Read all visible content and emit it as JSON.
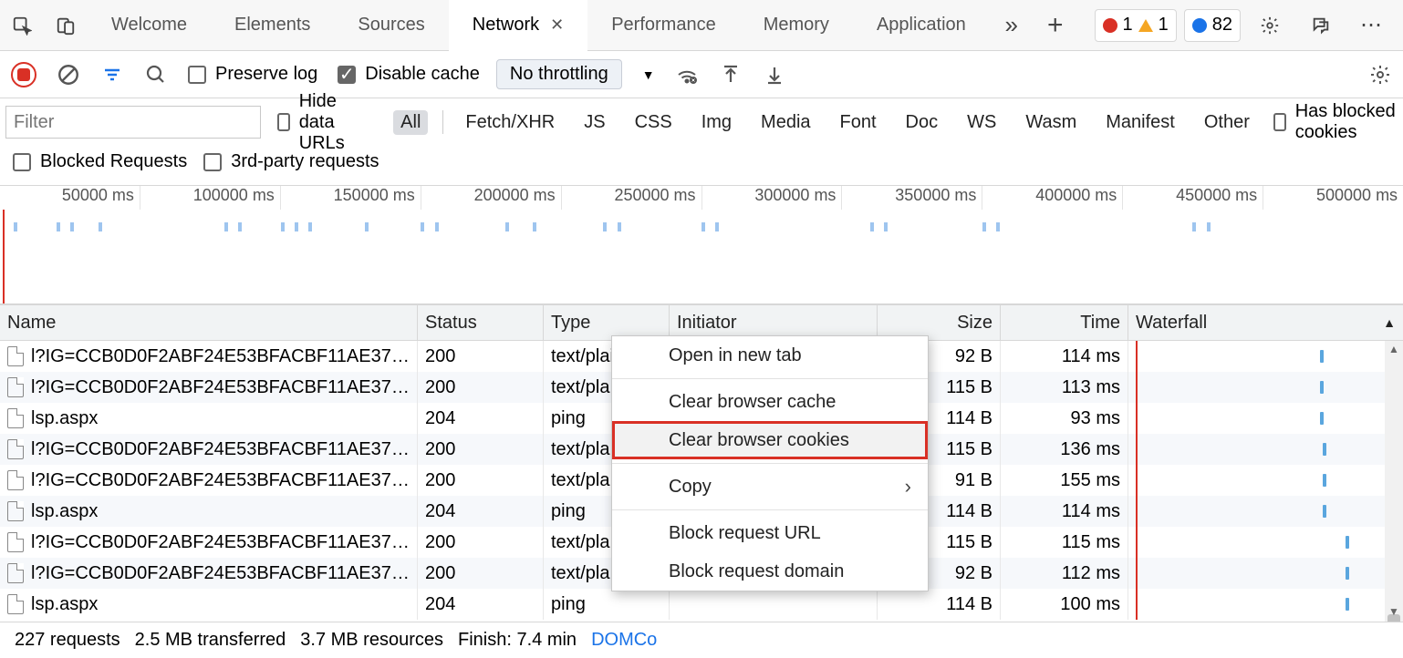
{
  "tabs": {
    "items": [
      {
        "label": "Welcome"
      },
      {
        "label": "Elements"
      },
      {
        "label": "Sources"
      },
      {
        "label": "Network",
        "active": true
      },
      {
        "label": "Performance"
      },
      {
        "label": "Memory"
      },
      {
        "label": "Application"
      }
    ]
  },
  "tabbar_badges": {
    "errors": "1",
    "warnings": "1",
    "issues": "82"
  },
  "toolbar": {
    "preserve_log": "Preserve log",
    "disable_cache": "Disable cache",
    "throttling": "No throttling"
  },
  "filterbar": {
    "placeholder": "Filter",
    "hide_data_urls": "Hide data URLs",
    "types": [
      "All",
      "Fetch/XHR",
      "JS",
      "CSS",
      "Img",
      "Media",
      "Font",
      "Doc",
      "WS",
      "Wasm",
      "Manifest",
      "Other"
    ],
    "active_type": "All",
    "has_blocked_cookies": "Has blocked cookies",
    "blocked_requests": "Blocked Requests",
    "third_party": "3rd-party requests"
  },
  "overview": {
    "ticks": [
      "50000 ms",
      "100000 ms",
      "150000 ms",
      "200000 ms",
      "250000 ms",
      "300000 ms",
      "350000 ms",
      "400000 ms",
      "450000 ms",
      "500000 ms"
    ],
    "blips_pct": [
      1,
      4,
      5,
      7,
      16,
      17,
      20,
      21,
      22,
      26,
      30,
      31,
      36,
      38,
      43,
      44,
      50,
      51,
      62,
      63,
      70,
      71,
      85,
      86
    ]
  },
  "table": {
    "headers": {
      "name": "Name",
      "status": "Status",
      "type": "Type",
      "initiator": "Initiator",
      "size": "Size",
      "time": "Time",
      "waterfall": "Waterfall"
    },
    "rows": [
      {
        "name": "l?IG=CCB0D0F2ABF24E53BFACBF11AE3798F4...",
        "status": "200",
        "type": "text/plai",
        "size": "92 B",
        "time": "114 ms",
        "wf": 88
      },
      {
        "name": "l?IG=CCB0D0F2ABF24E53BFACBF11AE3798F4...",
        "status": "200",
        "type": "text/pla",
        "size": "115 B",
        "time": "113 ms",
        "wf": 88
      },
      {
        "name": "lsp.aspx",
        "status": "204",
        "type": "ping",
        "size": "114 B",
        "time": "93 ms",
        "wf": 88
      },
      {
        "name": "l?IG=CCB0D0F2ABF24E53BFACBF11AE3798F4...",
        "status": "200",
        "type": "text/pla",
        "size": "115 B",
        "time": "136 ms",
        "wf": 89
      },
      {
        "name": "l?IG=CCB0D0F2ABF24E53BFACBF11AE3798F4...",
        "status": "200",
        "type": "text/pla",
        "size": "91 B",
        "time": "155 ms",
        "wf": 89
      },
      {
        "name": "lsp.aspx",
        "status": "204",
        "type": "ping",
        "size": "114 B",
        "time": "114 ms",
        "wf": 89
      },
      {
        "name": "l?IG=CCB0D0F2ABF24E53BFACBF11AE3798F4...",
        "status": "200",
        "type": "text/pla",
        "size": "115 B",
        "time": "115 ms",
        "wf": 100
      },
      {
        "name": "l?IG=CCB0D0F2ABF24E53BFACBF11AE3798F4...",
        "status": "200",
        "type": "text/pla",
        "size": "92 B",
        "time": "112 ms",
        "wf": 100
      },
      {
        "name": "lsp.aspx",
        "status": "204",
        "type": "ping",
        "size": "114 B",
        "time": "100 ms",
        "wf": 100
      }
    ]
  },
  "context_menu": {
    "items": [
      {
        "label": "Open in new tab"
      },
      {
        "sep": true
      },
      {
        "label": "Clear browser cache"
      },
      {
        "label": "Clear browser cookies",
        "highlight": true
      },
      {
        "sep": true
      },
      {
        "label": "Copy",
        "submenu": true
      },
      {
        "sep": true
      },
      {
        "label": "Block request URL"
      },
      {
        "label": "Block request domain"
      }
    ]
  },
  "statusbar": {
    "requests": "227 requests",
    "transferred": "2.5 MB transferred",
    "resources": "3.7 MB resources",
    "finish": "Finish: 7.4 min",
    "domc": "DOMCo"
  }
}
